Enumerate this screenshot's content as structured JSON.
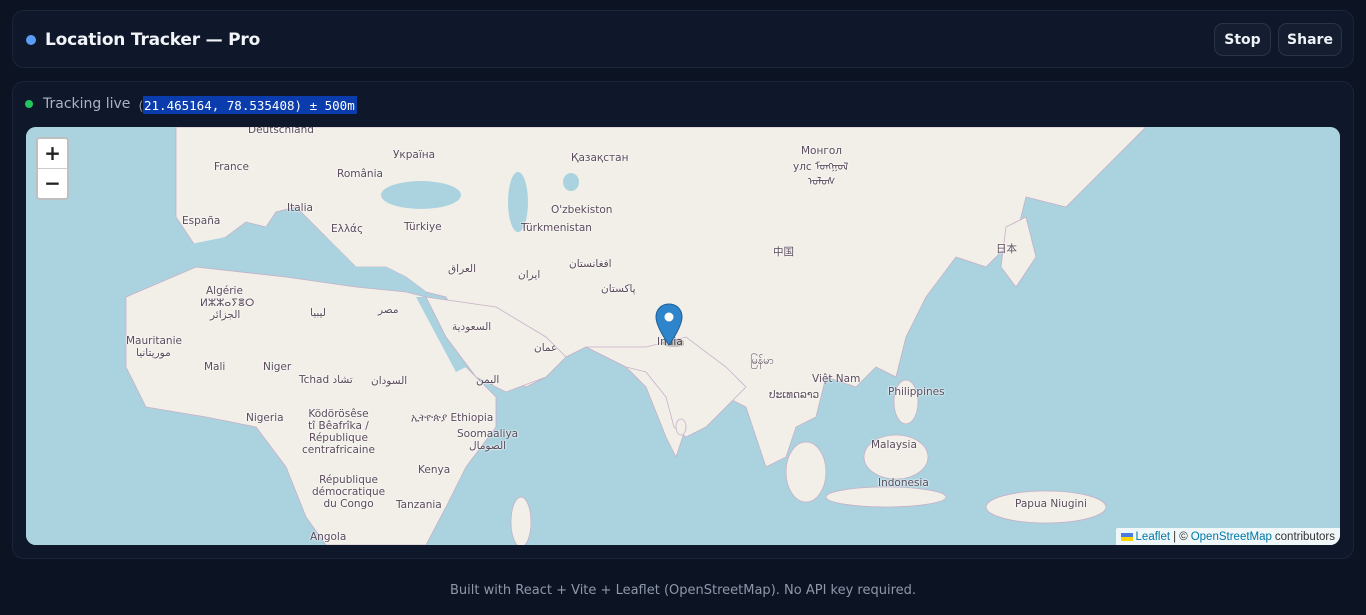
{
  "header": {
    "title": "Location Tracker — Pro",
    "buttons": {
      "stop": "Stop",
      "share": "Share"
    }
  },
  "status": {
    "label": "Tracking live",
    "open_paren": "(",
    "coords_text": "21.465164, 78.535408) ± 500m",
    "live_color": "#22c55e"
  },
  "map": {
    "zoom_in": "+",
    "zoom_out": "−",
    "marker_icon": "map-pin-icon",
    "labels": {
      "deutschland": "Deutschland",
      "ukraina": "Україна",
      "kazakhstan": "Қазақстан",
      "mongol_cyr": "Монгол",
      "mongol_trad": "улс ᠮᠣᠩᠭᠣᠯ",
      "mongol_trad2": "ᠤᠯᠤᠰ",
      "france": "France",
      "romania": "România",
      "italia": "Italia",
      "uzbekiston": "O'zbekiston",
      "espana": "España",
      "ellada": "Ελλάς",
      "turkiye": "Türkiye",
      "turkmenistan": "Türkmenistan",
      "china": "中国",
      "japan": "日本",
      "algerie": "Algérie",
      "algerie2": "ⵍⵣⵣⴰⵢⴻⵔ",
      "algerie3": "الجزائر",
      "iraq": "العراق",
      "iran": "ایران",
      "afghanistan": "افغانستان",
      "pakistan": "پاکستان",
      "libya": "ليبيا",
      "egypt": "مصر",
      "saudi": "السعودية",
      "india": "India",
      "mauritanie": "Mauritanie",
      "mauritanie2": "موريتانيا",
      "oman": "عمان",
      "myanmar": "မြန်မာ",
      "mali": "Mali",
      "niger": "Niger",
      "tchad": "Tchad تشاد",
      "sudan": "السودان",
      "yemen": "اليمن",
      "vietnam": "Việt Nam",
      "laos": "ປະເທດລາວ",
      "philippines": "Philippines",
      "nigeria": "Nigeria",
      "car": "Ködörösêse\ntî Bêafrîka /\nRépublique\ncentrafricaine",
      "ethiopia": "ኢትዮጵያ Ethiopia",
      "somalia": "Soomaaliya\nالصومال",
      "malaysia": "Malaysia",
      "kenya": "Kenya",
      "indonesia": "Indonesia",
      "drc": "République\ndémocratique\ndu Congo",
      "tanzania": "Tanzania",
      "png": "Papua Niugini",
      "angola": "Angola"
    },
    "attribution": {
      "leaflet": "Leaflet",
      "sep": "| ©",
      "osm": "OpenStreetMap",
      "contributors": "contributors"
    }
  },
  "footer": {
    "text": "Built with React + Vite + Leaflet (OpenStreetMap). No API key required."
  }
}
